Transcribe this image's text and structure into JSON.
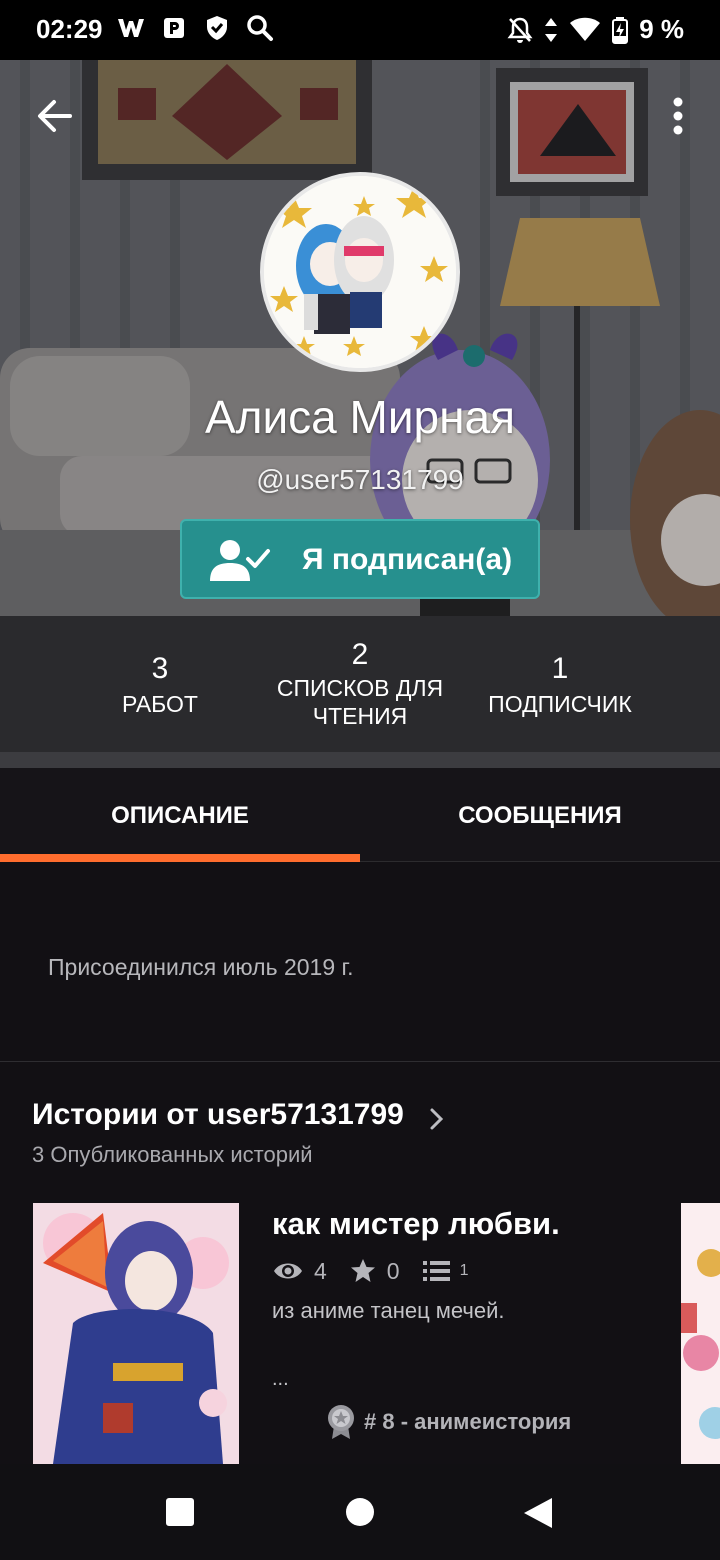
{
  "status_bar": {
    "time": "02:29",
    "battery_text": "9 %",
    "icons_left": [
      "wattpad-icon",
      "parking-icon",
      "shield-icon",
      "search-icon"
    ],
    "icons_right": [
      "bell-off-icon",
      "data-arrows-icon",
      "wifi-icon",
      "battery-charging-icon"
    ]
  },
  "header": {
    "display_name": "Алиса Мирная",
    "handle": "@user57131799",
    "follow_label": "Я подписан(а)",
    "accent_color": "#26908e"
  },
  "stats": [
    {
      "number": "3",
      "label": "РАБОТ"
    },
    {
      "number": "2",
      "label_line1": "СПИСКОВ ДЛЯ",
      "label_line2": "ЧТЕНИЯ"
    },
    {
      "number": "1",
      "label": "ПОДПИСЧИК"
    }
  ],
  "tabs": [
    {
      "label": "ОПИСАНИЕ",
      "active": true
    },
    {
      "label": "СООБЩЕНИЯ",
      "active": false
    }
  ],
  "tab_indicator_color": "#ff6d2e",
  "about": {
    "joined": "Присоединился июль 2019 г."
  },
  "stories": {
    "title": "Истории от user57131799",
    "subtitle": "3 Опубликованных историй",
    "items": [
      {
        "title": "как мистер любви.",
        "reads": "4",
        "votes": "0",
        "parts": "1",
        "description": "из аниме танец мечей.",
        "ellipsis": "...",
        "rank": "# 8 - анимеистория"
      }
    ]
  }
}
